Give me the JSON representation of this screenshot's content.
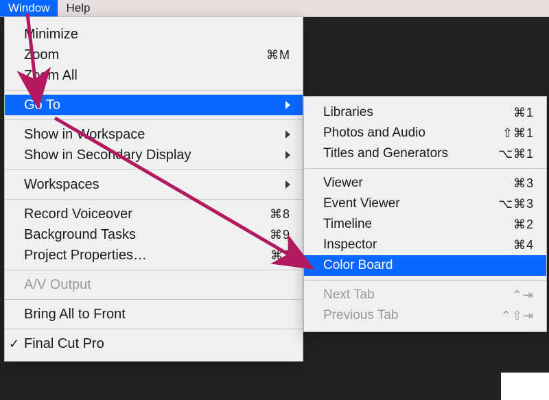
{
  "menubar": {
    "window": "Window",
    "help": "Help"
  },
  "windowMenu": {
    "minimize": "Minimize",
    "zoom": "Zoom",
    "zoom_sc": "⌘M",
    "zoomAll": "Zoom All",
    "goTo": "Go To",
    "showInWorkspace": "Show in Workspace",
    "showInSecondary": "Show in Secondary Display",
    "workspaces": "Workspaces",
    "recordVoiceover": "Record Voiceover",
    "recordVoiceover_sc": "⌘8",
    "backgroundTasks": "Background Tasks",
    "backgroundTasks_sc": "⌘9",
    "projectProperties": "Project Properties…",
    "projectProperties_sc": "⌘J",
    "avOutput": "A/V Output",
    "bringAll": "Bring All to Front",
    "finalCutPro": "Final Cut Pro"
  },
  "goToMenu": {
    "libraries": "Libraries",
    "libraries_sc": "⌘1",
    "photosAudio": "Photos and Audio",
    "photosAudio_sc": "⇧⌘1",
    "titlesGen": "Titles and Generators",
    "titlesGen_sc": "⌥⌘1",
    "viewer": "Viewer",
    "viewer_sc": "⌘3",
    "eventViewer": "Event Viewer",
    "eventViewer_sc": "⌥⌘3",
    "timeline": "Timeline",
    "timeline_sc": "⌘2",
    "inspector": "Inspector",
    "inspector_sc": "⌘4",
    "colorBoard": "Color Board",
    "nextTab": "Next Tab",
    "nextTab_sc": "⌃⇥",
    "prevTab": "Previous Tab",
    "prevTab_sc": "⌃⇧⇥"
  },
  "annotation": {
    "arrow_color": "#b3195f"
  }
}
